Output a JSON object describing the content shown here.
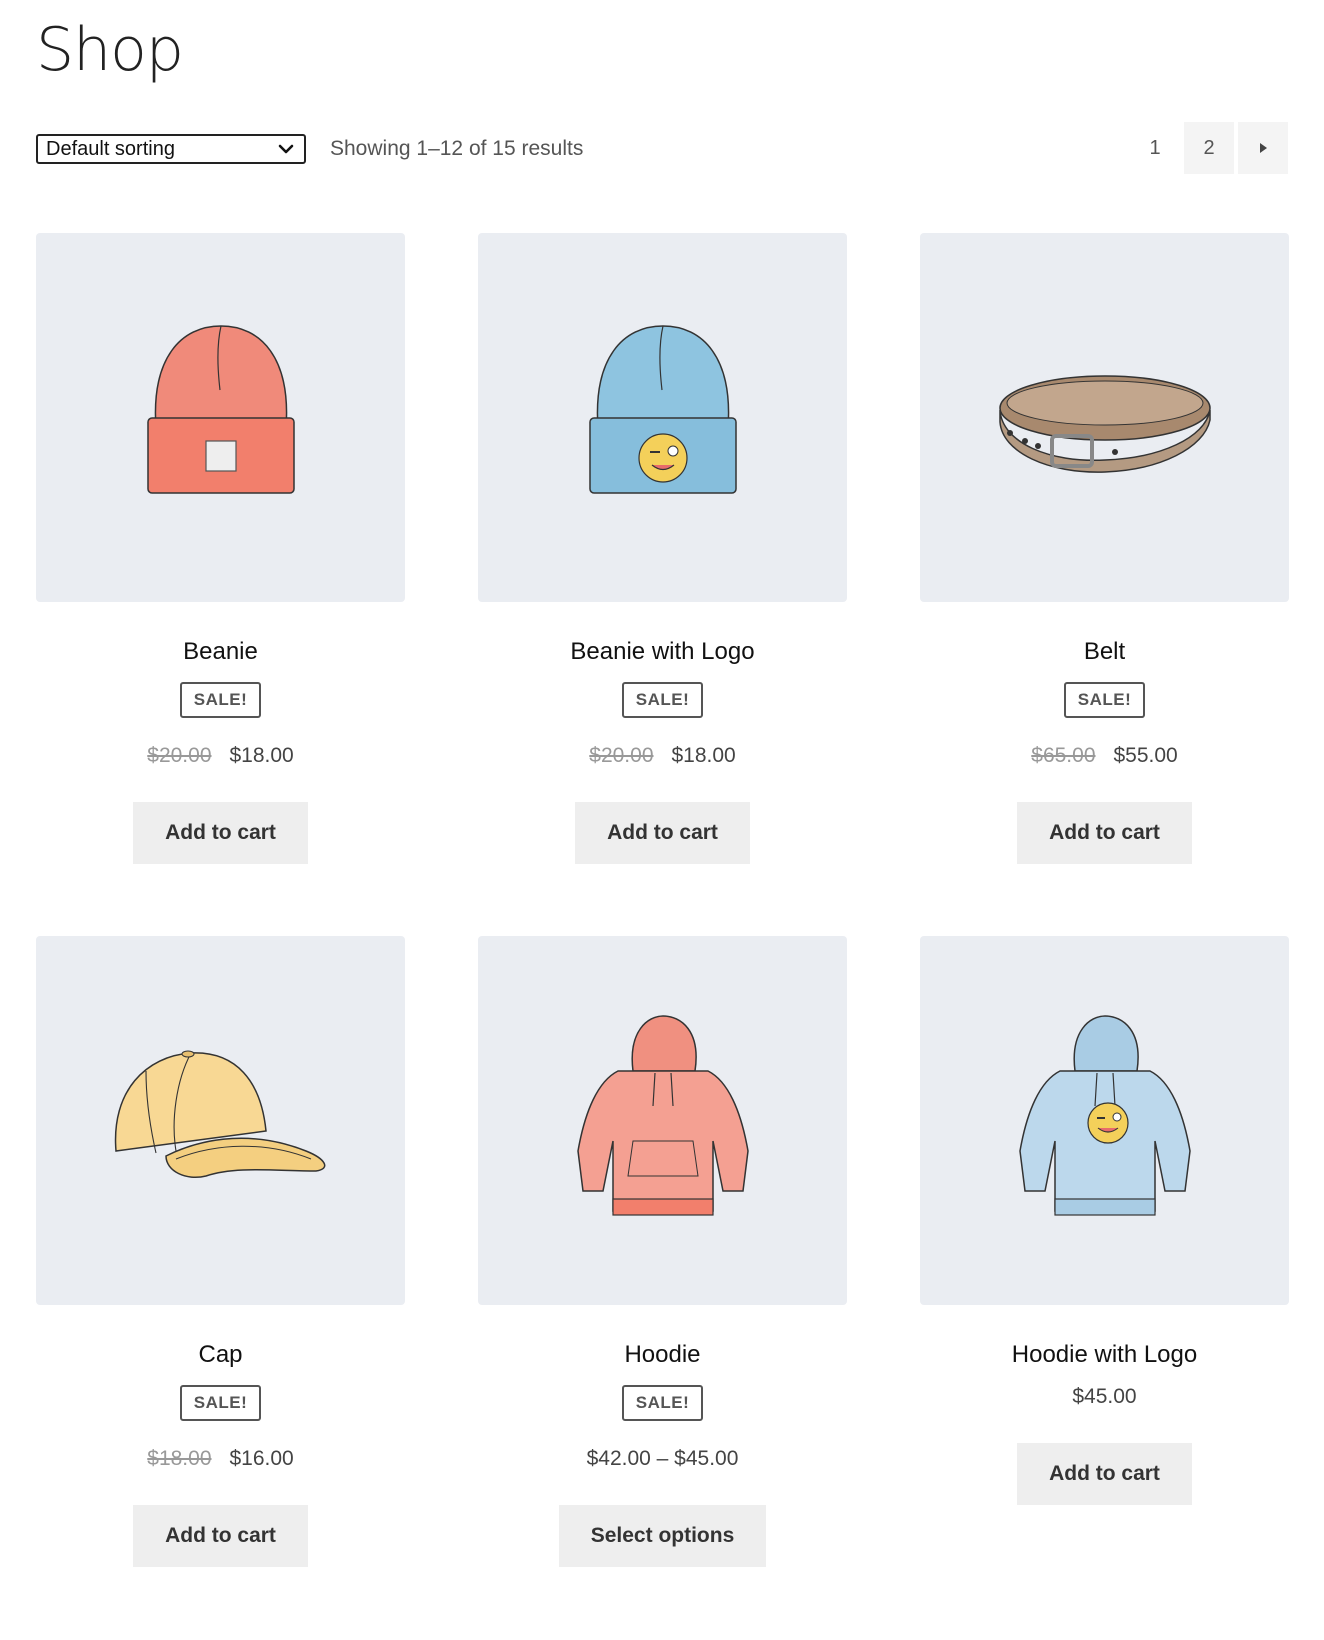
{
  "page": {
    "title": "Shop"
  },
  "toolbar": {
    "sort_value": "Default sorting",
    "result_count": "Showing 1–12 of 15 results",
    "pagination": {
      "current": "1",
      "next_page": "2",
      "next_icon": "caret-right-icon"
    }
  },
  "products": [
    {
      "name": "Beanie",
      "badge": "SALE!",
      "regular_price": "$20.00",
      "sale_price": "$18.00",
      "button": "Add to cart",
      "image": "beanie-orange"
    },
    {
      "name": "Beanie with Logo",
      "badge": "SALE!",
      "regular_price": "$20.00",
      "sale_price": "$18.00",
      "button": "Add to cart",
      "image": "beanie-blue-logo"
    },
    {
      "name": "Belt",
      "badge": "SALE!",
      "regular_price": "$65.00",
      "sale_price": "$55.00",
      "button": "Add to cart",
      "image": "belt-brown"
    },
    {
      "name": "Cap",
      "badge": "SALE!",
      "regular_price": "$18.00",
      "sale_price": "$16.00",
      "button": "Add to cart",
      "image": "cap-yellow"
    },
    {
      "name": "Hoodie",
      "badge": "SALE!",
      "price_range": "$42.00 – $45.00",
      "button": "Select options",
      "image": "hoodie-pink"
    },
    {
      "name": "Hoodie with Logo",
      "price": "$45.00",
      "button": "Add to cart",
      "image": "hoodie-blue-logo"
    }
  ],
  "colors": {
    "thumb_bg": "#eaedf2",
    "button_bg": "#eeeeee",
    "beanie": "#f08a7a",
    "beanie_logo": "#8ec4e0",
    "belt": "#b49a82",
    "cap": "#f8d894",
    "hoodie": "#f4a092",
    "hoodie_logo": "#bcd8ec",
    "emoji": "#f4d05a"
  }
}
